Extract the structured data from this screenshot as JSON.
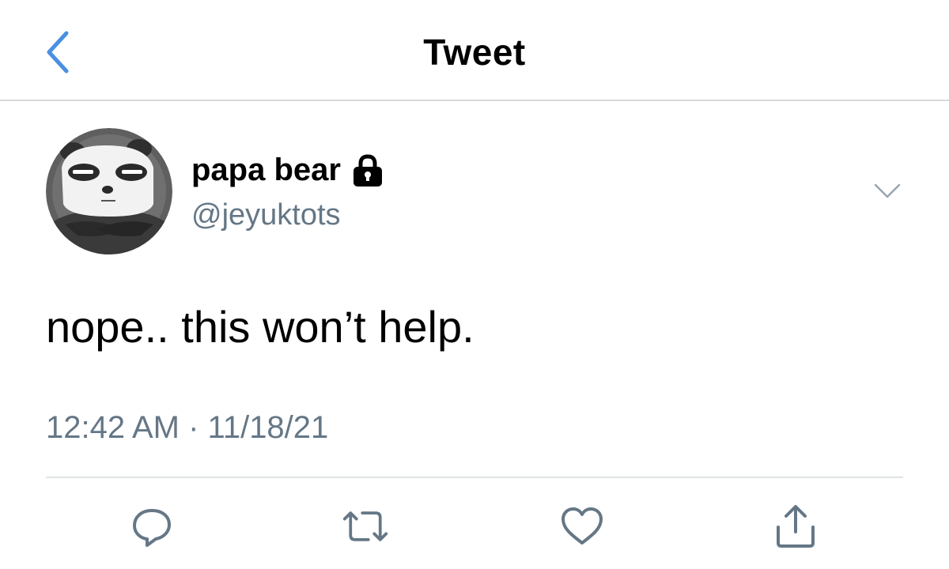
{
  "header": {
    "title": "Tweet",
    "back_icon": "chevron-left-icon",
    "accent_color": "#4a90e2"
  },
  "tweet": {
    "author_name": "papa bear",
    "author_handle": "@jeyuktots",
    "protected_icon": "lock-icon",
    "more_icon": "chevron-down-icon",
    "avatar_icon": "panda-avatar",
    "text": "nope.. this won’t help.",
    "timestamp": "12:42 AM · 11/18/21"
  },
  "actions": {
    "reply_icon": "reply-icon",
    "retweet_icon": "retweet-icon",
    "like_icon": "heart-icon",
    "share_icon": "share-icon",
    "icon_color": "#657786"
  }
}
